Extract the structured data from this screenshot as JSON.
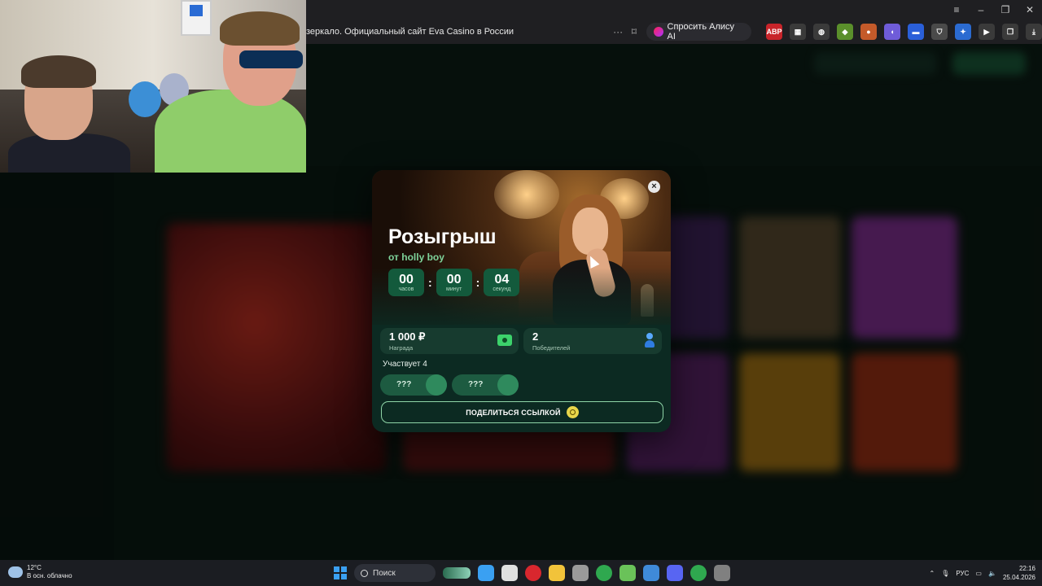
{
  "browser": {
    "address_text": "зеркало. Официальный сайт Eva Casino в России",
    "more_glyph": "···",
    "alice_button": "Спросить Алису AI",
    "extensions": [
      {
        "name": "adblock-icon",
        "label": "ABP",
        "color": "#c8242a"
      },
      {
        "name": "qr-icon",
        "label": "▦",
        "color": "#3a3a3a"
      },
      {
        "name": "globe-icon",
        "label": "◍",
        "color": "#3a3a3a"
      },
      {
        "name": "puzzle-icon",
        "label": "◆",
        "color": "#5a8f2b"
      },
      {
        "name": "fox-icon",
        "label": "●",
        "color": "#c45a2a"
      },
      {
        "name": "cloud-icon",
        "label": "◖",
        "color": "#6f5cd9"
      },
      {
        "name": "card-icon",
        "label": "▬",
        "color": "#2a5fd9"
      },
      {
        "name": "shield-icon",
        "label": "⛉",
        "color": "#4a4a4a"
      },
      {
        "name": "gear-blue-icon",
        "label": "✦",
        "color": "#2b6bd1"
      },
      {
        "name": "media-icon",
        "label": "▶",
        "color": "#3a3a3a"
      },
      {
        "name": "collections-icon",
        "label": "❐",
        "color": "#3a3a3a"
      },
      {
        "name": "download-icon",
        "label": "⤓",
        "color": "#3a3a3a"
      }
    ]
  },
  "modal": {
    "title": "Розыгрыш",
    "subtitle": "от holly boy",
    "timer": [
      {
        "value": "00",
        "label": "часов"
      },
      {
        "value": "00",
        "label": "минут"
      },
      {
        "value": "04",
        "label": "секунд"
      }
    ],
    "timer_separator": ":",
    "close_glyph": "×",
    "prize": {
      "value": "1 000 ₽",
      "label": "Награда"
    },
    "winners": {
      "value": "2",
      "label": "Победителей"
    },
    "participants_text": "Участвует 4",
    "participants": [
      "???",
      "???"
    ],
    "share_label": "ПОДЕЛИТЬСЯ ССЫЛКОЙ"
  },
  "taskbar": {
    "weather_temp": "12°C",
    "weather_desc": "В осн. облачно",
    "search_label": "Поиск",
    "apps": [
      "#3aa0f2",
      "#e0e0e0",
      "#d9272e",
      "#f2c33a",
      "#9a9a9a",
      "#2fa84f",
      "#6ac259",
      "#3f8ad9",
      "#5865f2",
      "#2fa84f",
      "#808080"
    ],
    "lang": "РУС",
    "time": "22:16",
    "date": "25.04.2026"
  }
}
